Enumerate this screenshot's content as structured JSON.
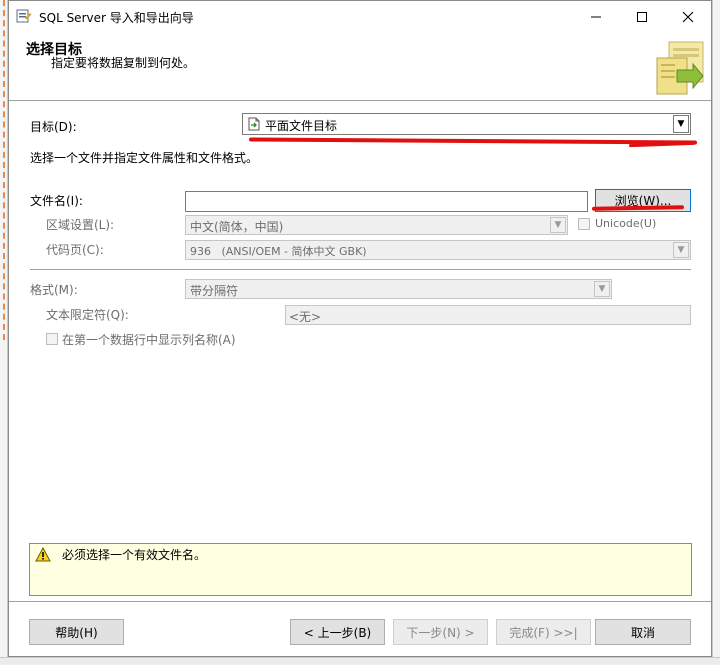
{
  "window": {
    "title": "SQL Server 导入和导出向导"
  },
  "header": {
    "title": "选择目标",
    "subtitle": "指定要将数据复制到何处。"
  },
  "destination": {
    "label": "目标(D):",
    "value": "平面文件目标"
  },
  "instruction": "选择一个文件并指定文件属性和文件格式。",
  "file": {
    "name_label": "文件名(I):",
    "name_value": "",
    "browse_label": "浏览(W)...",
    "locale_label": "区域设置(L):",
    "locale_value": "中文(简体，中国)",
    "unicode_label": "Unicode(U)",
    "codepage_label": "代码页(C):",
    "codepage_value": "936   (ANSI/OEM - 简体中文 GBK)"
  },
  "format": {
    "label": "格式(M):",
    "value": "带分隔符",
    "qualifier_label": "文本限定符(Q):",
    "qualifier_value": "<无>",
    "header_row_label": "在第一个数据行中显示列名称(A)"
  },
  "message": {
    "text": "必须选择一个有效文件名。",
    "icon": "warning-icon"
  },
  "footer": {
    "help": "帮助(H)",
    "back": "< 上一步(B)",
    "next": "下一步(N) >",
    "finish": "完成(F) >>|",
    "cancel": "取消"
  },
  "colors": {
    "annotation": "#e01010",
    "message_bg": "#ffffe1",
    "focus": "#0078d7"
  }
}
